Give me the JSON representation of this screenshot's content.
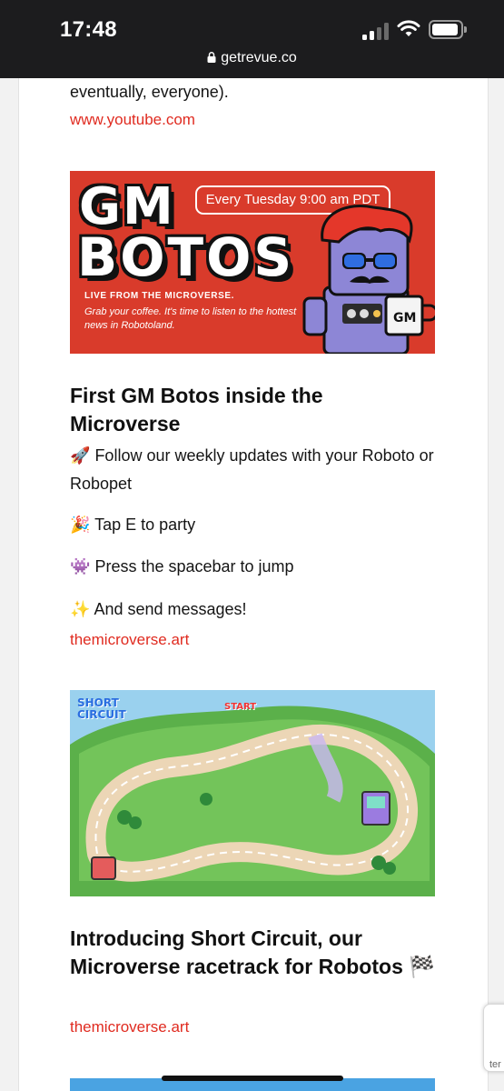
{
  "status_bar": {
    "time": "17:48",
    "url": "getrevue.co"
  },
  "article": {
    "intro_tail": "eventually, everyone).",
    "intro_link": "www.youtube.com",
    "banner": {
      "title_line1": "GM",
      "title_line2": "BOTOS",
      "schedule": "Every Tuesday 9:00 am PDT",
      "live_text": "LIVE FROM THE MICROVERSE.",
      "tagline": "Grab your coffee. It's time to listen to the hottest news in Robotoland.",
      "mug_text": "GM"
    },
    "section1": {
      "title": "First GM Botos inside the Microverse",
      "bullets": [
        {
          "emoji": "🚀",
          "text": "Follow our weekly updates with your Roboto or Robopet"
        },
        {
          "emoji": "🎉",
          "text": "Tap E to party"
        },
        {
          "emoji": "👾",
          "text": "Press the spacebar to jump"
        },
        {
          "emoji": "✨",
          "text": "And send messages!"
        }
      ],
      "link": "themicroverse.art"
    },
    "track_image": {
      "logo_line1": "SHORT",
      "logo_line2": "CIRCUIT",
      "start_label": "START"
    },
    "section2": {
      "title": "Introducing Short Circuit, our Microverse racetrack for Robotos",
      "emoji": "🏁",
      "link": "themicroverse.art"
    }
  },
  "colors": {
    "link": "#e02b20",
    "banner_bg": "#d93b2b",
    "status_bg": "#1c1c1e"
  }
}
